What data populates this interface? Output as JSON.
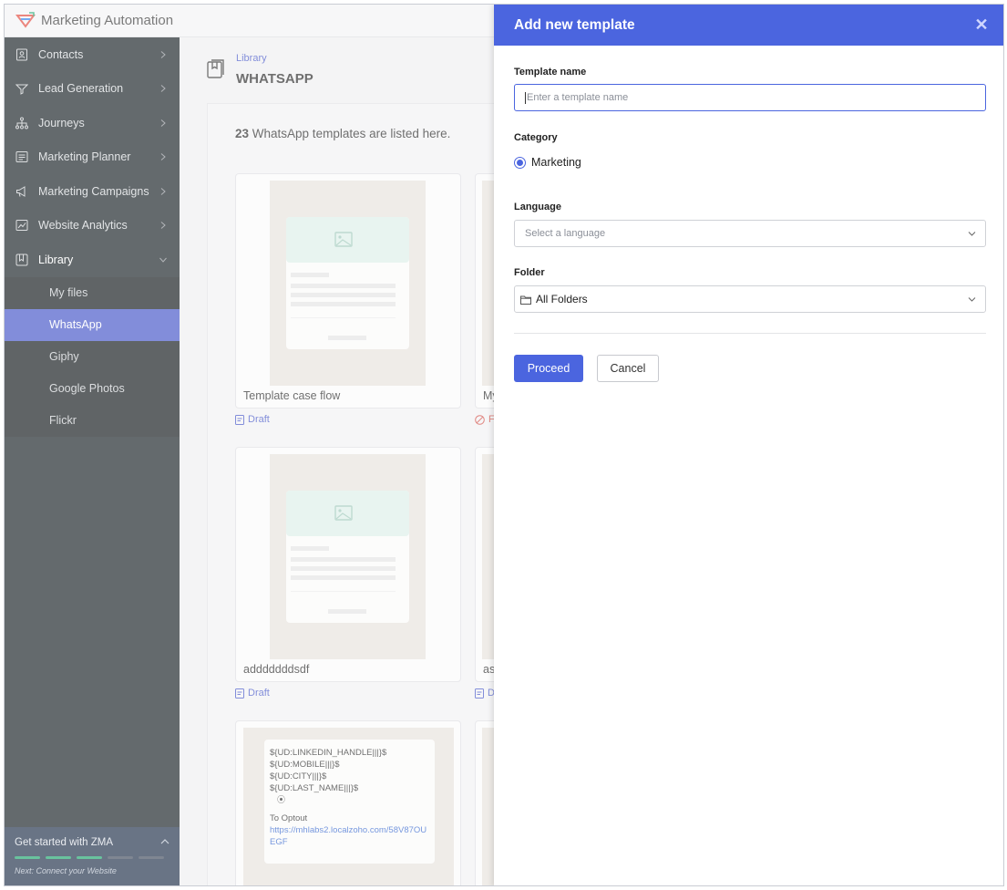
{
  "app": {
    "title": "Marketing Automation"
  },
  "sidebar": {
    "items": [
      {
        "label": "Contacts"
      },
      {
        "label": "Lead Generation"
      },
      {
        "label": "Journeys"
      },
      {
        "label": "Marketing Planner"
      },
      {
        "label": "Marketing Campaigns"
      },
      {
        "label": "Website Analytics"
      },
      {
        "label": "Library"
      }
    ],
    "sub_items": [
      {
        "label": "My files"
      },
      {
        "label": "WhatsApp"
      },
      {
        "label": "Giphy"
      },
      {
        "label": "Google Photos"
      },
      {
        "label": "Flickr"
      }
    ],
    "get_started": {
      "title": "Get started with ZMA",
      "next": "Next: Connect your Website",
      "steps_total": 5,
      "steps_done": 3
    }
  },
  "main": {
    "breadcrumb": "Library",
    "title": "WHATSAPP",
    "count_num": "23",
    "count_text": " WhatsApp templates are listed here.",
    "cards": [
      {
        "name": "Template case flow",
        "status": "Draft"
      },
      {
        "name": "adddddddsdf",
        "status": "Draft"
      },
      {
        "name": "My",
        "status": "F"
      },
      {
        "name": "as",
        "status": "D"
      }
    ],
    "card3_lines": [
      "${UD:LINKEDIN_HANDLE|||}$",
      "${UD:MOBILE|||}$",
      "${UD:CITY|||}$",
      "${UD:LAST_NAME|||}$"
    ],
    "card3_optout": "To Optout",
    "card3_link": "https://mhlabs2.localzoho.com/58V87OUEGF"
  },
  "panel": {
    "title": "Add new template",
    "template_name_label": "Template name",
    "template_name_placeholder": "Enter a template name",
    "category_label": "Category",
    "category_value": "Marketing",
    "language_label": "Language",
    "language_placeholder": "Select a language",
    "folder_label": "Folder",
    "folder_value": "All Folders",
    "proceed": "Proceed",
    "cancel": "Cancel"
  },
  "colors": {
    "accent": "#4b65df",
    "sidebar": "#121b1f",
    "active": "#3f51c6",
    "success": "#19a46a"
  }
}
